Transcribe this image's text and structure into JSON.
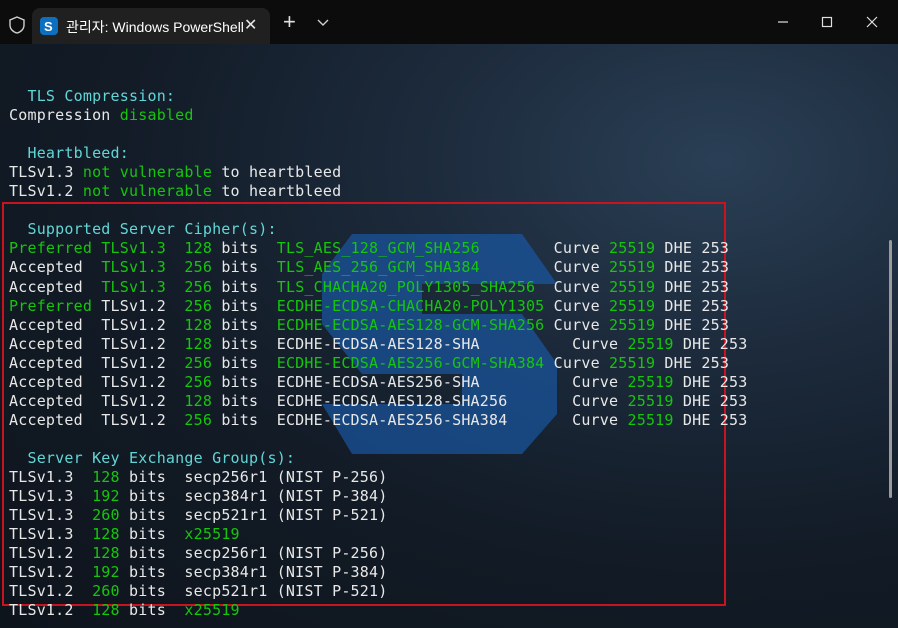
{
  "titlebar": {
    "tab_title": "관리자: Windows PowerShell",
    "tab_icon": "powershell-logo-icon",
    "new_tab": "+",
    "controls": [
      "minimize-icon",
      "maximize-icon",
      "close-icon"
    ]
  },
  "colors": {
    "heading": "#61d6d6",
    "value_green": "#16c60c",
    "text": "#e8e8e8",
    "highlight_border": "#c8141e"
  },
  "terminal": {
    "lines": [
      [],
      [
        [
          "  TLS Compression:",
          "c"
        ]
      ],
      [
        [
          "Compression ",
          "w"
        ],
        [
          "disabled",
          "g"
        ]
      ],
      [],
      [
        [
          "  Heartbleed:",
          "c"
        ]
      ],
      [
        [
          "TLSv1.3 ",
          "w"
        ],
        [
          "not vulnerable",
          "g"
        ],
        [
          " to heartbleed",
          "w"
        ]
      ],
      [
        [
          "TLSv1.2 ",
          "w"
        ],
        [
          "not vulnerable",
          "g"
        ],
        [
          " to heartbleed",
          "w"
        ]
      ],
      [],
      [
        [
          "  Supported Server Cipher(s):",
          "c"
        ]
      ],
      [
        [
          "Preferred",
          "g"
        ],
        [
          " TLSv1.3  ",
          "g"
        ],
        [
          "128",
          "g"
        ],
        [
          " bits  ",
          "w"
        ],
        [
          "TLS_AES_128_GCM_SHA256",
          "g"
        ],
        [
          "        Curve ",
          "w"
        ],
        [
          "25519",
          "g"
        ],
        [
          " DHE 253",
          "w"
        ]
      ],
      [
        [
          "Accepted  ",
          "w"
        ],
        [
          "TLSv1.3",
          "g"
        ],
        [
          "  ",
          "w"
        ],
        [
          "256",
          "g"
        ],
        [
          " bits  ",
          "w"
        ],
        [
          "TLS_AES_256_GCM_SHA384",
          "g"
        ],
        [
          "        Curve ",
          "w"
        ],
        [
          "25519",
          "g"
        ],
        [
          " DHE 253",
          "w"
        ]
      ],
      [
        [
          "Accepted  ",
          "w"
        ],
        [
          "TLSv1.3",
          "g"
        ],
        [
          "  ",
          "w"
        ],
        [
          "256",
          "g"
        ],
        [
          " bits  ",
          "w"
        ],
        [
          "TLS_CHACHA20_POLY1305_SHA256",
          "g"
        ],
        [
          "  Curve ",
          "w"
        ],
        [
          "25519",
          "g"
        ],
        [
          " DHE 253",
          "w"
        ]
      ],
      [
        [
          "Preferred",
          "g"
        ],
        [
          " TLSv1.2  ",
          "w"
        ],
        [
          "256",
          "g"
        ],
        [
          " bits  ",
          "w"
        ],
        [
          "ECDHE-ECDSA-CHACHA20-POLY1305",
          "g"
        ],
        [
          " Curve ",
          "w"
        ],
        [
          "25519",
          "g"
        ],
        [
          " DHE 253",
          "w"
        ]
      ],
      [
        [
          "Accepted  TLSv1.2  ",
          "w"
        ],
        [
          "128",
          "g"
        ],
        [
          " bits  ",
          "w"
        ],
        [
          "ECDHE-ECDSA-AES128-GCM-SHA256",
          "g"
        ],
        [
          " Curve ",
          "w"
        ],
        [
          "25519",
          "g"
        ],
        [
          " DHE 253",
          "w"
        ]
      ],
      [
        [
          "Accepted  TLSv1.2  ",
          "w"
        ],
        [
          "128",
          "g"
        ],
        [
          " bits  ECDHE-ECDSA-AES128-SHA          Curve ",
          "w"
        ],
        [
          "25519",
          "g"
        ],
        [
          " DHE 253",
          "w"
        ]
      ],
      [
        [
          "Accepted  TLSv1.2  ",
          "w"
        ],
        [
          "256",
          "g"
        ],
        [
          " bits  ",
          "w"
        ],
        [
          "ECDHE-ECDSA-AES256-GCM-SHA384",
          "g"
        ],
        [
          " Curve ",
          "w"
        ],
        [
          "25519",
          "g"
        ],
        [
          " DHE 253",
          "w"
        ]
      ],
      [
        [
          "Accepted  TLSv1.2  ",
          "w"
        ],
        [
          "256",
          "g"
        ],
        [
          " bits  ECDHE-ECDSA-AES256-SHA          Curve ",
          "w"
        ],
        [
          "25519",
          "g"
        ],
        [
          " DHE 253",
          "w"
        ]
      ],
      [
        [
          "Accepted  TLSv1.2  ",
          "w"
        ],
        [
          "128",
          "g"
        ],
        [
          " bits  ECDHE-ECDSA-AES128-SHA256       Curve ",
          "w"
        ],
        [
          "25519",
          "g"
        ],
        [
          " DHE 253",
          "w"
        ]
      ],
      [
        [
          "Accepted  TLSv1.2  ",
          "w"
        ],
        [
          "256",
          "g"
        ],
        [
          " bits  ECDHE-ECDSA-AES256-SHA384       Curve ",
          "w"
        ],
        [
          "25519",
          "g"
        ],
        [
          " DHE 253",
          "w"
        ]
      ],
      [],
      [
        [
          "  Server Key Exchange Group(s):",
          "c"
        ]
      ],
      [
        [
          "TLSv1.3  ",
          "w"
        ],
        [
          "128",
          "g"
        ],
        [
          " bits  secp256r1 (NIST P-256)",
          "w"
        ]
      ],
      [
        [
          "TLSv1.3  ",
          "w"
        ],
        [
          "192",
          "g"
        ],
        [
          " bits  secp384r1 (NIST P-384)",
          "w"
        ]
      ],
      [
        [
          "TLSv1.3  ",
          "w"
        ],
        [
          "260",
          "g"
        ],
        [
          " bits  secp521r1 (NIST P-521)",
          "w"
        ]
      ],
      [
        [
          "TLSv1.3  ",
          "w"
        ],
        [
          "128",
          "g"
        ],
        [
          " bits  ",
          "w"
        ],
        [
          "x25519",
          "g"
        ]
      ],
      [
        [
          "TLSv1.2  ",
          "w"
        ],
        [
          "128",
          "g"
        ],
        [
          " bits  secp256r1 (NIST P-256)",
          "w"
        ]
      ],
      [
        [
          "TLSv1.2  ",
          "w"
        ],
        [
          "192",
          "g"
        ],
        [
          " bits  secp384r1 (NIST P-384)",
          "w"
        ]
      ],
      [
        [
          "TLSv1.2  ",
          "w"
        ],
        [
          "260",
          "g"
        ],
        [
          " bits  secp521r1 (NIST P-521)",
          "w"
        ]
      ],
      [
        [
          "TLSv1.2  ",
          "w"
        ],
        [
          "128",
          "g"
        ],
        [
          " bits  ",
          "w"
        ],
        [
          "x25519",
          "g"
        ]
      ]
    ]
  }
}
